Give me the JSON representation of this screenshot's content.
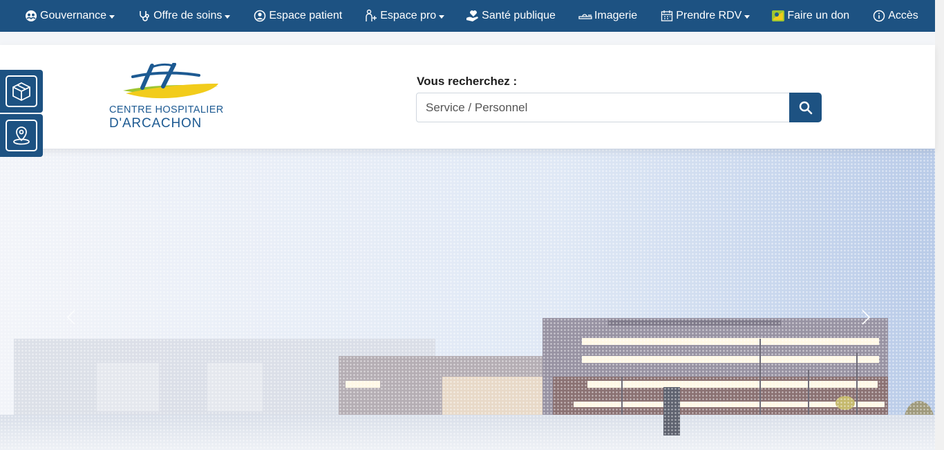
{
  "nav": {
    "items": [
      {
        "label": "Gouvernance",
        "icon": "people-icon",
        "dropdown": true
      },
      {
        "label": "Offre de soins",
        "icon": "stethoscope-icon",
        "dropdown": true
      },
      {
        "label": "Espace patient",
        "icon": "user-circle-icon",
        "dropdown": false
      },
      {
        "label": "Espace pro",
        "icon": "medical-staff-icon",
        "dropdown": true
      },
      {
        "label": "Santé publique",
        "icon": "hand-heart-icon",
        "dropdown": false
      },
      {
        "label": "Imagerie",
        "icon": "scanner-icon",
        "dropdown": false
      },
      {
        "label": "Prendre RDV",
        "icon": "calendar-icon",
        "dropdown": true
      },
      {
        "label": "Faire un don",
        "icon": "donation-icon",
        "dropdown": false
      },
      {
        "label": "Accès",
        "icon": "info-icon",
        "dropdown": false
      }
    ]
  },
  "header": {
    "logo_line1": "CENTRE HOSPITALIER",
    "logo_line2": "D'ARCACHON",
    "search_label": "Vous recherchez :",
    "search_placeholder": "Service / Personnel"
  },
  "side_buttons": [
    {
      "icon": "package-icon"
    },
    {
      "icon": "map-pin-icon"
    }
  ],
  "colors": {
    "primary": "#1d5282",
    "logo_blue": "#1d5a92",
    "logo_yellow": "#f2cc1b",
    "logo_green": "#9ec531"
  }
}
